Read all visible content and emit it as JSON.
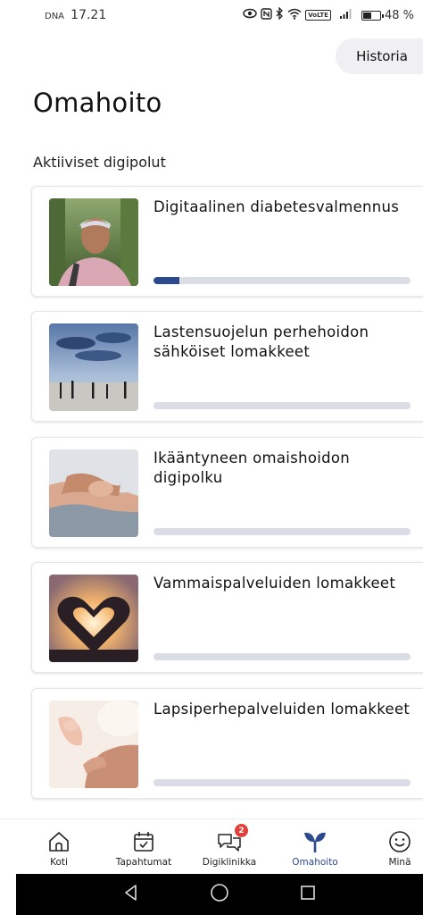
{
  "status_bar": {
    "carrier": "DNA",
    "time": "17.21",
    "battery": "48 %",
    "battery_level": 0.48
  },
  "header": {
    "history_label": "Historia",
    "title": "Omahoito"
  },
  "section": {
    "title": "Aktiiviset digipolut"
  },
  "cards": [
    {
      "title": "Digitaalinen diabetesvalmennus",
      "progress": 0.1,
      "image": "woman-outdoors-photo"
    },
    {
      "title": "Lastensuojelun perhehoidon sähköiset lomakkeet",
      "progress": 0,
      "image": "beach-silhouettes-photo"
    },
    {
      "title": "Ikääntyneen omaishoidon digipolku",
      "progress": 0,
      "image": "holding-hands-photo"
    },
    {
      "title": "Vammaispalveluiden lomakkeet",
      "progress": 0,
      "image": "heart-hands-photo"
    },
    {
      "title": "Lapsiperhepalveluiden lomakkeet",
      "progress": 0,
      "image": "baby-hand-photo"
    }
  ],
  "nav": {
    "items": [
      {
        "label": "Koti",
        "icon": "home-icon"
      },
      {
        "label": "Tapahtumat",
        "icon": "calendar-icon"
      },
      {
        "label": "Digiklinikka",
        "icon": "chat-icon",
        "badge": "2"
      },
      {
        "label": "Omahoito",
        "icon": "sprout-icon",
        "active": true
      },
      {
        "label": "Minä",
        "icon": "smiley-icon"
      }
    ]
  },
  "colors": {
    "accent": "#2c4a8c",
    "progress_track": "#dadce6",
    "badge": "#e0403a"
  }
}
